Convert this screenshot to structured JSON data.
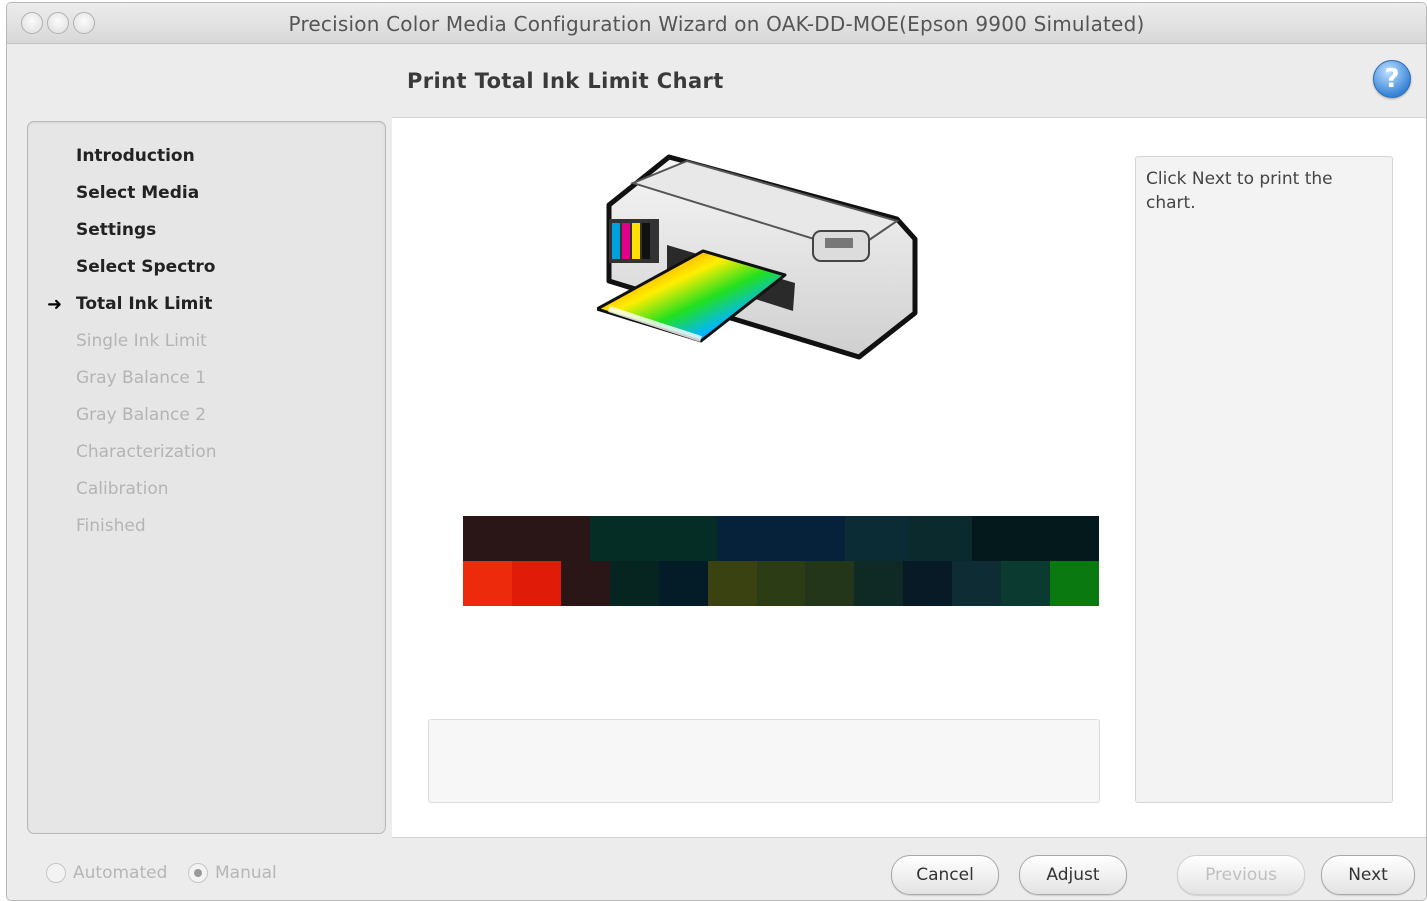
{
  "window": {
    "title": "Precision Color Media Configuration Wizard on OAK-DD-MOE(Epson 9900 Simulated)"
  },
  "header": {
    "title": "Print Total Ink Limit Chart",
    "help_icon": "question-mark-icon"
  },
  "steps": {
    "current_marker_icon": "arrow-right-icon",
    "items": [
      {
        "label": "Introduction",
        "state": "done"
      },
      {
        "label": "Select Media",
        "state": "done"
      },
      {
        "label": "Settings",
        "state": "done"
      },
      {
        "label": "Select Spectro",
        "state": "done"
      },
      {
        "label": "Total Ink Limit",
        "state": "current"
      },
      {
        "label": "Single Ink Limit",
        "state": "pending"
      },
      {
        "label": "Gray Balance 1",
        "state": "pending"
      },
      {
        "label": "Gray Balance 2",
        "state": "pending"
      },
      {
        "label": "Characterization",
        "state": "pending"
      },
      {
        "label": "Calibration",
        "state": "pending"
      },
      {
        "label": "Finished",
        "state": "pending"
      }
    ]
  },
  "main": {
    "illustration": "printer-icon",
    "chart_preview": {
      "top_row_colors": [
        "#2a1616",
        "#2a1616",
        "#062c26",
        "#062c26",
        "#06213a",
        "#06213a",
        "#0c2c35",
        "#0a2a2d",
        "#04191c",
        "#04191c"
      ],
      "bottom_row_colors": [
        "#ee2a0c",
        "#e01c08",
        "#2a1616",
        "#062420",
        "#041c28",
        "#3a4212",
        "#2c3c14",
        "#24361a",
        "#0f2a24",
        "#081a26",
        "#0e2c34",
        "#0a3a30",
        "#0a7a10"
      ]
    },
    "message": ""
  },
  "help_panel": {
    "text": "Click Next to print the chart."
  },
  "footer": {
    "mode_automated": "Automated",
    "mode_manual": "Manual",
    "selected_mode": "Manual",
    "cancel": "Cancel",
    "adjust": "Adjust",
    "previous": "Previous",
    "next": "Next"
  }
}
